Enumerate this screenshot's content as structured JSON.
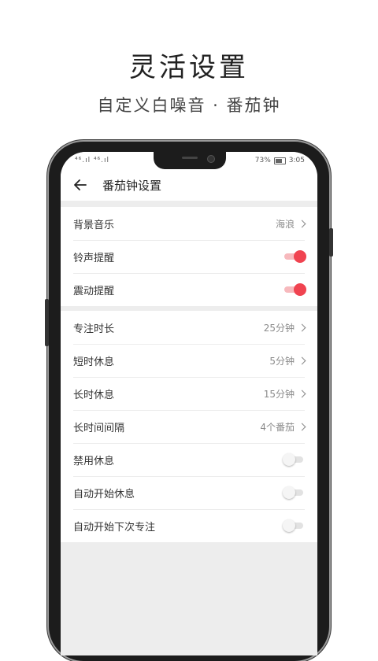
{
  "promo": {
    "headline": "灵活设置",
    "subline": "自定义白噪音 · 番茄钟"
  },
  "statusbar": {
    "signal_text": "⁴⁶.ıl ⁴⁶.ıl",
    "battery_percent": "73%",
    "time": "3:05"
  },
  "appbar": {
    "title": "番茄钟设置"
  },
  "group1": [
    {
      "label": "背景音乐",
      "value": "海浪"
    },
    {
      "label": "铃声提醒",
      "on": true
    },
    {
      "label": "震动提醒",
      "on": true
    }
  ],
  "group2": [
    {
      "label": "专注时长",
      "value": "25分钟"
    },
    {
      "label": "短时休息",
      "value": "5分钟"
    },
    {
      "label": "长时休息",
      "value": "15分钟"
    },
    {
      "label": "长时间间隔",
      "value": "4个番茄"
    },
    {
      "label": "禁用休息",
      "on": false
    },
    {
      "label": "自动开始休息",
      "on": false
    },
    {
      "label": "自动开始下次专注",
      "on": false
    }
  ],
  "colors": {
    "accent": "#f04350",
    "background": "#ededed"
  }
}
